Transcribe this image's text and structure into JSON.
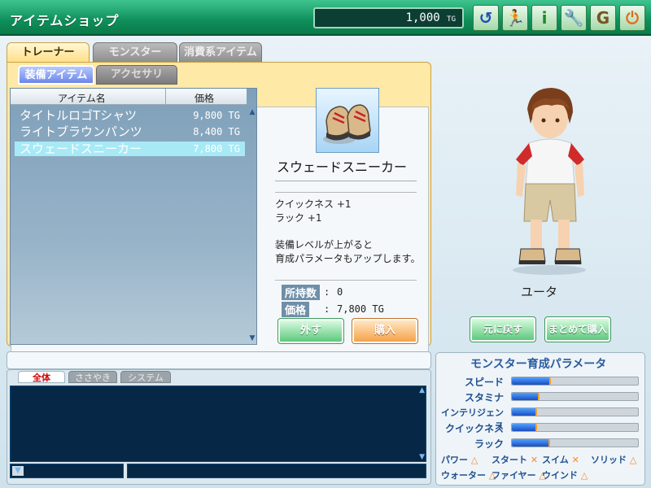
{
  "header": {
    "title": "アイテムショップ",
    "money": "1,000",
    "money_unit": "TG",
    "buttons": [
      {
        "icon": "return-arrow-icon",
        "glyph": "↺"
      },
      {
        "icon": "running-man-icon",
        "glyph": "🏃"
      },
      {
        "icon": "info-icon",
        "glyph": "i"
      },
      {
        "icon": "wrench-icon",
        "glyph": "🔧"
      },
      {
        "icon": "money-bag-icon",
        "glyph": "G"
      },
      {
        "icon": "power-icon",
        "glyph": "⏻"
      }
    ]
  },
  "tabs": {
    "main": [
      "トレーナー",
      "モンスター",
      "消費系アイテム"
    ],
    "sub": [
      "装備アイテム",
      "アクセサリ"
    ]
  },
  "item_list": {
    "col_name": "アイテム名",
    "col_price": "価格",
    "items": [
      {
        "name": "タイトルロゴTシャツ",
        "price": "9,800 TG"
      },
      {
        "name": "ライトブラウンパンツ",
        "price": "8,400 TG"
      },
      {
        "name": "スウェードスニーカー",
        "price": "7,800 TG"
      }
    ]
  },
  "detail": {
    "name": "スウェードスニーカー",
    "effect1": "クイックネス +1",
    "effect2": "ラック +1",
    "desc1": "装備レベルが上がると",
    "desc2": "育成パラメータもアップします。",
    "owned_label": "所持数",
    "owned_value": "0",
    "price_label": "価格",
    "price_value": "7,800 TG",
    "colon": ":",
    "unequip_button": "外す",
    "buy_button": "購入"
  },
  "character": {
    "name": "ユータ",
    "revert_button": "元に戻す",
    "bulk_buy_button": "まとめて購入"
  },
  "chat": {
    "tabs": [
      "全体",
      "ささやき",
      "システム"
    ]
  },
  "params": {
    "title": "モンスター育成パラメータ",
    "stats": [
      {
        "label": "スピード",
        "value": 0.31
      },
      {
        "label": "スタミナ",
        "value": 0.22
      },
      {
        "label": "インテリジェンス",
        "value": 0.2
      },
      {
        "label": "クイックネス",
        "value": 0.2
      },
      {
        "label": "ラック",
        "value": 0.3
      }
    ],
    "elements_row1": [
      {
        "label": "パワー",
        "mark": "△"
      },
      {
        "label": "スタート",
        "mark": "✕"
      },
      {
        "label": "スイム",
        "mark": "✕"
      },
      {
        "label": "ソリッド",
        "mark": "△"
      }
    ],
    "elements_row2": [
      {
        "label": "ウォーター",
        "mark": "△"
      },
      {
        "label": "ファイヤー",
        "mark": "△"
      },
      {
        "label": "ウインド",
        "mark": "△"
      }
    ]
  }
}
